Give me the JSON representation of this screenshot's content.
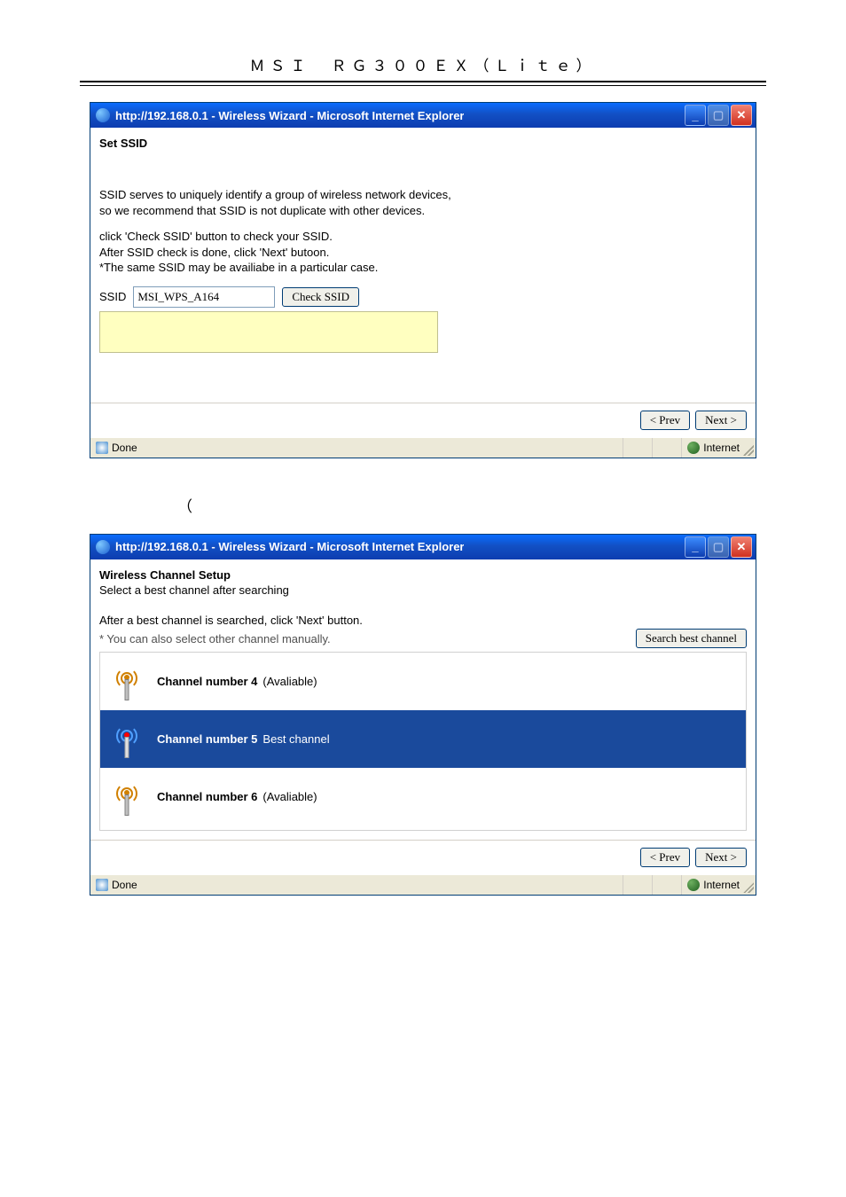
{
  "doc_title": "ＭＳＩ　ＲＧ３００ＥＸ（Ｌｉｔｅ）",
  "paren": "（",
  "window1": {
    "title": "http://192.168.0.1 - Wireless Wizard - Microsoft Internet Explorer",
    "heading": "Set SSID",
    "para1_l1": "SSID serves to uniquely identify a group of wireless network devices,",
    "para1_l2": "so we recommend that SSID is not duplicate with other devices.",
    "para2_l1": "click 'Check SSID' button to check your SSID.",
    "para2_l2": "After SSID check is done, click 'Next' butoon.",
    "para2_l3": "*The same SSID may be availiabe in a particular case.",
    "ssid_label": "SSID",
    "ssid_value": "MSI_WPS_A164",
    "check_btn": "Check SSID",
    "prev": "< Prev",
    "next": "Next >",
    "status_done": "Done",
    "status_zone": "Internet"
  },
  "window2": {
    "title": "http://192.168.0.1 - Wireless Wizard - Microsoft Internet Explorer",
    "heading": "Wireless Channel Setup",
    "subheading": "Select a best channel after searching",
    "line1": "After a best channel is searched, click 'Next' button.",
    "line2": "* You can also select other channel manually.",
    "search_btn": "Search best channel",
    "channels": [
      {
        "num": "Channel number 4",
        "status": "(Avaliable)",
        "selected": false
      },
      {
        "num": "Channel number 5",
        "status": "Best channel",
        "selected": true
      },
      {
        "num": "Channel number 6",
        "status": "(Avaliable)",
        "selected": false
      }
    ],
    "prev": "< Prev",
    "next": "Next >",
    "status_done": "Done",
    "status_zone": "Internet"
  }
}
